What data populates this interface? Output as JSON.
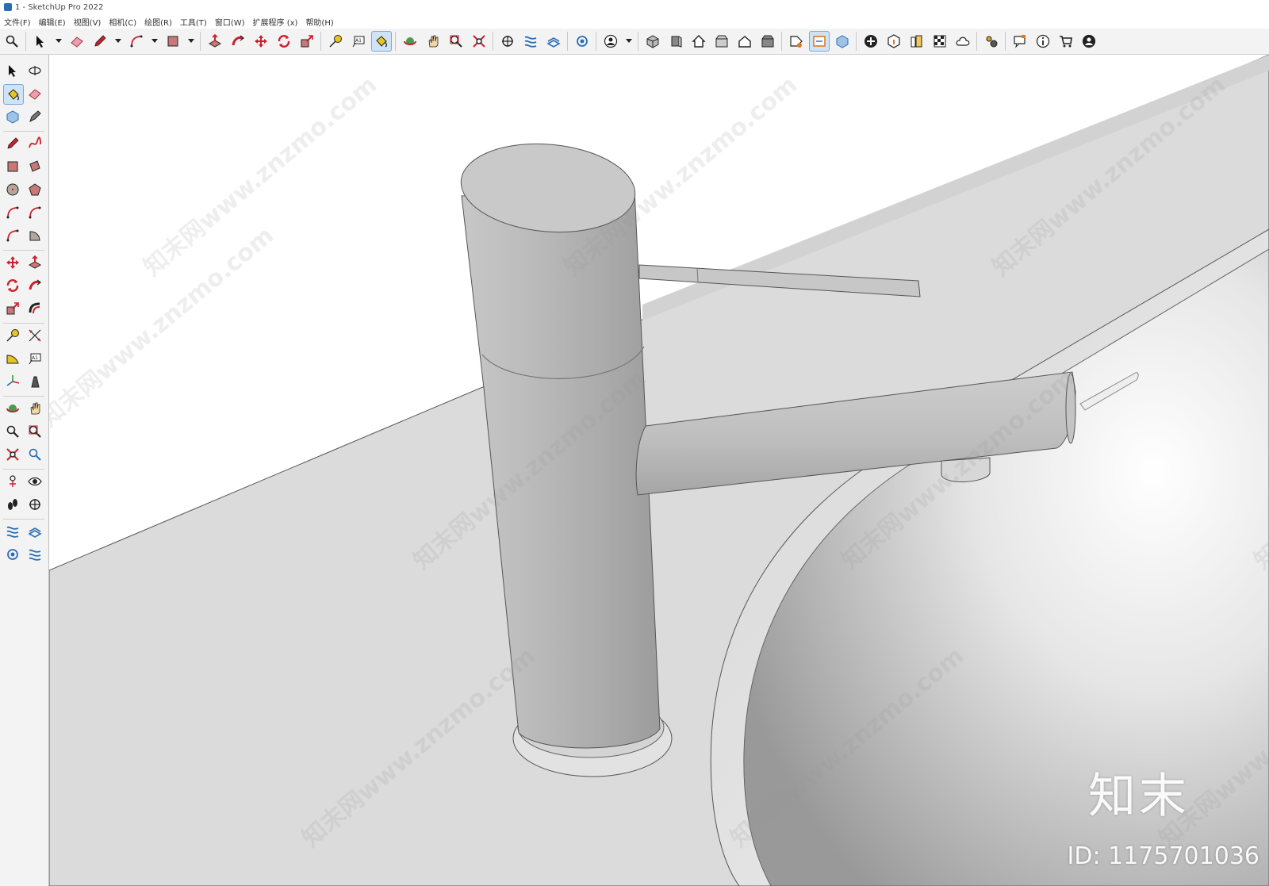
{
  "window": {
    "title": "1 - SketchUp Pro 2022"
  },
  "menu": [
    "文件(F)",
    "编辑(E)",
    "视图(V)",
    "相机(C)",
    "绘图(R)",
    "工具(T)",
    "窗口(W)",
    "扩展程序 (x)",
    "帮助(H)"
  ],
  "colors": {
    "accent": "#cc1f2a",
    "select_blue": "#cfe3f7",
    "tool_yellow": "#e8c420",
    "tool_blue": "#2a6db5"
  },
  "toolbar": {
    "groups": [
      [
        "zoom-icon"
      ],
      [
        "select-icon",
        "dropdown-icon",
        "eraser-icon",
        "pencil-icon",
        "dropdown-icon",
        "arc-icon",
        "dropdown-icon",
        "rectangle-icon",
        "dropdown-icon"
      ],
      [
        "push-pull-icon",
        "follow-me-icon",
        "move-icon",
        "rotate-icon",
        "scale-icon"
      ],
      [
        "tape-measure-icon",
        "text-icon",
        "paint-bucket-icon"
      ],
      [
        "orbit-icon",
        "pan-icon",
        "zoom-window-icon",
        "zoom-extents-icon"
      ],
      [
        "section-plane-icon",
        "section-display-icon",
        "section-fill-icon"
      ],
      [
        "section-cut-icon"
      ],
      [
        "user-icon",
        "dropdown-icon"
      ],
      [
        "iso-view-icon",
        "front-view-icon",
        "top-home-icon",
        "right-view-icon",
        "back-house-icon",
        "left-view-icon"
      ],
      [
        "tag-tool-icon",
        "outliner-icon",
        "component-swap-icon"
      ],
      [
        "add-location-icon",
        "3d-warehouse-icon",
        "report-icon",
        "materials-icon",
        "cloud-icon"
      ],
      [
        "extension-settings-icon"
      ],
      [
        "message-icon",
        "info-icon",
        "cart-icon",
        "account-icon"
      ]
    ]
  },
  "left_tools": [
    [
      "select-icon",
      "orbit-small-icon"
    ],
    [
      "paint-bucket-icon",
      "eraser-icon"
    ],
    [
      "component-icon",
      "tag-icon"
    ],
    [
      "pencil-icon",
      "freehand-icon"
    ],
    [
      "rectangle-icon",
      "rotated-rectangle-icon"
    ],
    [
      "circle-icon",
      "polygon-icon"
    ],
    [
      "arc-icon",
      "two-point-arc-icon"
    ],
    [
      "three-point-arc-icon",
      "pie-icon"
    ],
    [
      "move-icon",
      "push-pull-icon"
    ],
    [
      "rotate-icon",
      "follow-me-icon"
    ],
    [
      "scale-icon",
      "offset-icon"
    ],
    [
      "tape-measure-icon",
      "dimension-icon"
    ],
    [
      "protractor-icon",
      "text-icon"
    ],
    [
      "axes-icon",
      "3d-text-icon"
    ],
    [
      "orbit-icon",
      "pan-icon"
    ],
    [
      "zoom-icon",
      "zoom-window-icon"
    ],
    [
      "zoom-extents-icon",
      "previous-view-icon"
    ],
    [
      "position-camera-icon",
      "look-around-icon"
    ],
    [
      "walk-icon",
      "section-plane-icon"
    ],
    [
      "section-display-icon",
      "section-fill-icon"
    ],
    [
      "section-cut-icon",
      "section-toggle-icon"
    ]
  ],
  "watermark": {
    "text": "知末网www.znzmo.com",
    "brand": "知末",
    "id_label": "ID: 1175701036"
  }
}
